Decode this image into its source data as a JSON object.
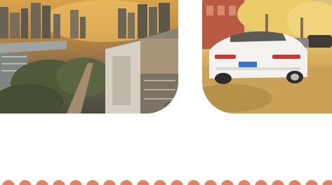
{
  "photos": [
    {
      "icon": "city-skyline-photo",
      "caption": "①"
    },
    {
      "icon": "parked-car-photo"
    }
  ],
  "decoration": {
    "border_icon": "scallop-border",
    "border_color": "#e8815a"
  }
}
